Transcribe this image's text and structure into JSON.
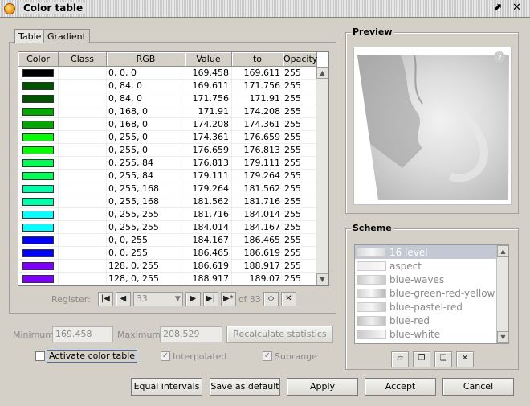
{
  "window": {
    "title": "Color table"
  },
  "tabs": [
    "Table",
    "Gradient"
  ],
  "table": {
    "headers": [
      "Color",
      "Class",
      "RGB",
      "Value",
      "to",
      "Opacity"
    ],
    "rows": [
      {
        "color": "#000000",
        "class": "",
        "rgb": "0, 0, 0",
        "value": "169.458",
        "to": "169.611",
        "opacity": "255"
      },
      {
        "color": "#005400",
        "class": "",
        "rgb": "0, 84, 0",
        "value": "169.611",
        "to": "171.756",
        "opacity": "255"
      },
      {
        "color": "#005400",
        "class": "",
        "rgb": "0, 84, 0",
        "value": "171.756",
        "to": "171.91",
        "opacity": "255"
      },
      {
        "color": "#00a800",
        "class": "",
        "rgb": "0, 168, 0",
        "value": "171.91",
        "to": "174.208",
        "opacity": "255"
      },
      {
        "color": "#00a800",
        "class": "",
        "rgb": "0, 168, 0",
        "value": "174.208",
        "to": "174.361",
        "opacity": "255"
      },
      {
        "color": "#00ff00",
        "class": "",
        "rgb": "0, 255, 0",
        "value": "174.361",
        "to": "176.659",
        "opacity": "255"
      },
      {
        "color": "#00ff00",
        "class": "",
        "rgb": "0, 255, 0",
        "value": "176.659",
        "to": "176.813",
        "opacity": "255"
      },
      {
        "color": "#00ff54",
        "class": "",
        "rgb": "0, 255, 84",
        "value": "176.813",
        "to": "179.111",
        "opacity": "255"
      },
      {
        "color": "#00ff54",
        "class": "",
        "rgb": "0, 255, 84",
        "value": "179.111",
        "to": "179.264",
        "opacity": "255"
      },
      {
        "color": "#00ffa8",
        "class": "",
        "rgb": "0, 255, 168",
        "value": "179.264",
        "to": "181.562",
        "opacity": "255"
      },
      {
        "color": "#00ffa8",
        "class": "",
        "rgb": "0, 255, 168",
        "value": "181.562",
        "to": "181.716",
        "opacity": "255"
      },
      {
        "color": "#00ffff",
        "class": "",
        "rgb": "0, 255, 255",
        "value": "181.716",
        "to": "184.014",
        "opacity": "255"
      },
      {
        "color": "#00ffff",
        "class": "",
        "rgb": "0, 255, 255",
        "value": "184.014",
        "to": "184.167",
        "opacity": "255"
      },
      {
        "color": "#0000ff",
        "class": "",
        "rgb": "0, 0, 255",
        "value": "184.167",
        "to": "186.465",
        "opacity": "255"
      },
      {
        "color": "#0000ff",
        "class": "",
        "rgb": "0, 0, 255",
        "value": "186.465",
        "to": "186.619",
        "opacity": "255"
      },
      {
        "color": "#8000ff",
        "class": "",
        "rgb": "128, 0, 255",
        "value": "186.619",
        "to": "188.917",
        "opacity": "255"
      },
      {
        "color": "#8000ff",
        "class": "",
        "rgb": "128, 0, 255",
        "value": "188.917",
        "to": "189.07",
        "opacity": "255"
      }
    ]
  },
  "register": {
    "label": "Register:",
    "current": "33",
    "of_label": "of 33"
  },
  "stats": {
    "minimum_label": "Minimum:",
    "minimum": "169.458",
    "maximum_label": "Maximum:",
    "maximum": "208.529",
    "recalc_label": "Recalculate statistics"
  },
  "options": {
    "activate_label": "Activate color table",
    "interpolated_label": "Interpolated",
    "subrange_label": "Subrange"
  },
  "preview": {
    "title": "Preview"
  },
  "scheme": {
    "title": "Scheme",
    "items": [
      "16 level",
      "aspect",
      "blue-waves",
      "blue-green-red-yellow",
      "blue-pastel-red",
      "blue-red",
      "blue-white"
    ]
  },
  "buttons": {
    "equal_intervals": "Equal intervals",
    "save_default": "Save as default",
    "apply": "Apply",
    "accept": "Accept",
    "cancel": "Cancel"
  }
}
